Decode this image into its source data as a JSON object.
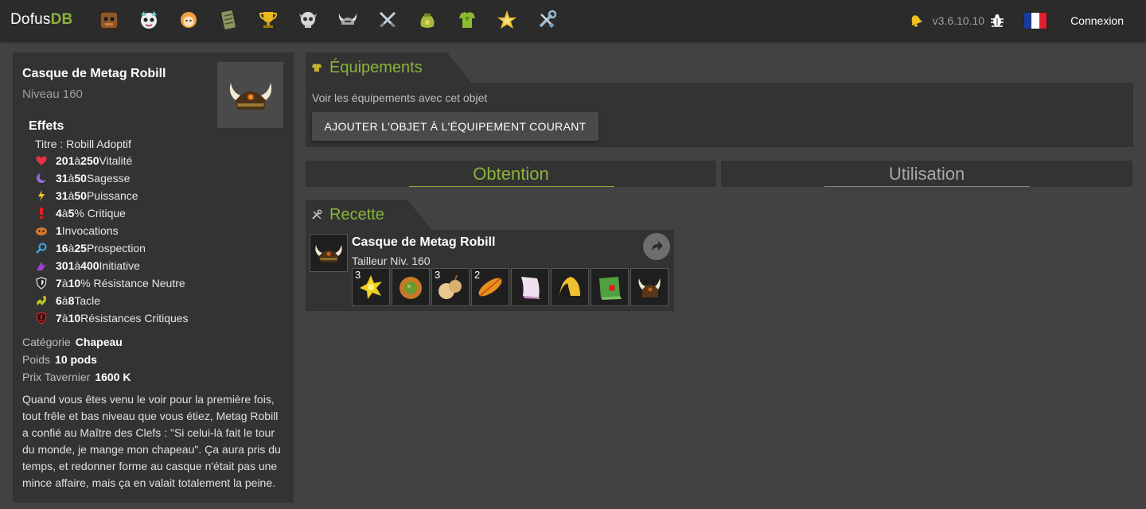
{
  "header": {
    "brand_prefix": "Dofus",
    "brand_suffix": "DB",
    "nav_icons": [
      "chest-icon",
      "bestiary-icon",
      "character-icon",
      "scroll-icon",
      "trophy-icon",
      "skull-icon",
      "horned-helmet-icon",
      "crossed-swords-icon",
      "sack-icon",
      "armor-icon",
      "star-icon",
      "tools-icon"
    ],
    "version": "v3.6.10.10",
    "login_label": "Connexion"
  },
  "item": {
    "name": "Casque de Metag Robill",
    "level": "Niveau 160",
    "effects_title": "Effets",
    "title_effect": "Titre : Robill Adoptif",
    "effects": [
      {
        "icon": "heart-icon",
        "min": "201",
        "sep": " à ",
        "max": "250",
        "suffix": " Vitalité"
      },
      {
        "icon": "moon-icon",
        "min": "31",
        "sep": " à ",
        "max": "50",
        "suffix": " Sagesse"
      },
      {
        "icon": "lightning-icon",
        "min": "31",
        "sep": " à ",
        "max": "50",
        "suffix": " Puissance"
      },
      {
        "icon": "exclamation-icon",
        "min": "4",
        "sep": " à ",
        "max": "5",
        "suffix": "% Critique"
      },
      {
        "icon": "summon-icon",
        "min": "1",
        "sep": "",
        "max": "",
        "suffix": " Invocations"
      },
      {
        "icon": "magnifier-icon",
        "min": "16",
        "sep": " à ",
        "max": "25",
        "suffix": " Prospection"
      },
      {
        "icon": "initiative-icon",
        "min": "301",
        "sep": " à ",
        "max": "400",
        "suffix": " Initiative"
      },
      {
        "icon": "shield-icon",
        "min": "7",
        "sep": " à ",
        "max": "10",
        "suffix": "% Résistance Neutre"
      },
      {
        "icon": "tackle-icon",
        "min": "6",
        "sep": " à ",
        "max": "8",
        "suffix": " Tacle"
      },
      {
        "icon": "critical-shield-icon",
        "min": "7",
        "sep": " à ",
        "max": "10",
        "suffix": " Résistances Critiques"
      }
    ],
    "category_label": "Catégorie",
    "category_value": "Chapeau",
    "weight_label": "Poids",
    "weight_value": "10 pods",
    "price_label": "Prix Tavernier",
    "price_value": "1600 K",
    "description": "Quand vous êtes venu le voir pour la première fois, tout frêle et bas niveau que vous étiez, Metag Robill a confié au Maître des Clefs : \"Si celui-là fait le tour du monde, je mange mon chapeau\". Ça aura pris du temps, et redonner forme au casque n'était pas une mince affaire, mais ça en valait totalement la peine."
  },
  "equipment": {
    "title": "Équipements",
    "text": "Voir les équipements avec cet objet",
    "button_label": "AJOUTER L'OBJET À L'ÉQUIPEMENT COURANT"
  },
  "tabs": {
    "obtention": "Obtention",
    "utilisation": "Utilisation",
    "active": "obtention"
  },
  "recipe": {
    "title": "Recette",
    "item_name": "Casque de Metag Robill",
    "job": "Tailleur Niv. 160",
    "ingredients": [
      {
        "icon": "yellow-flower-icon",
        "qty": "3"
      },
      {
        "icon": "round-bread-icon",
        "qty": ""
      },
      {
        "icon": "onion-bulb-icon",
        "qty": "3"
      },
      {
        "icon": "orange-feather-icon",
        "qty": "2"
      },
      {
        "icon": "parchment-icon",
        "qty": ""
      },
      {
        "icon": "golden-hat-icon",
        "qty": ""
      },
      {
        "icon": "green-scroll-icon",
        "qty": ""
      },
      {
        "icon": "horned-helmet-icon",
        "qty": ""
      }
    ]
  },
  "colors": {
    "accent": "#8bb33a",
    "panel": "#333333",
    "background": "#424242",
    "topbar": "#2b2b2b"
  }
}
